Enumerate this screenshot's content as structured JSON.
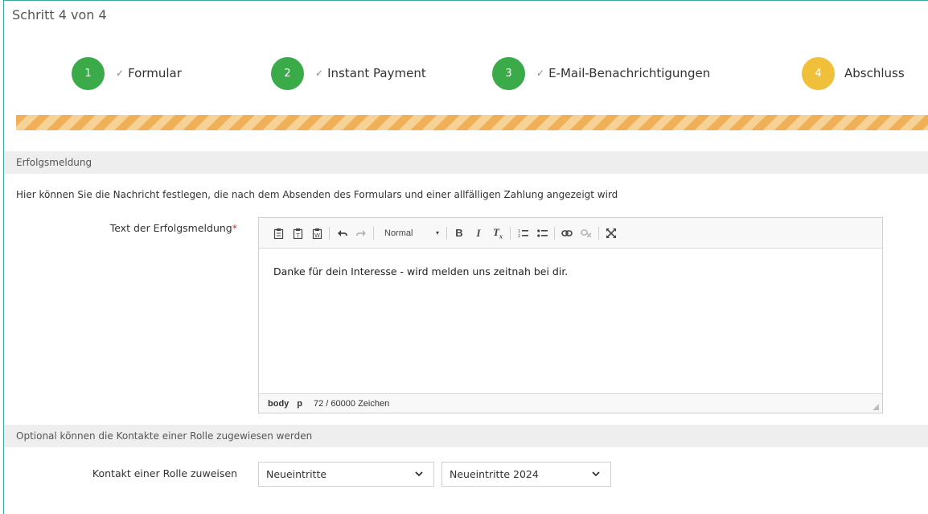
{
  "header": {
    "step_title": "Schritt 4 von 4"
  },
  "wizard": {
    "steps": [
      {
        "number": "1",
        "label": "Formular",
        "state": "done"
      },
      {
        "number": "2",
        "label": "Instant Payment",
        "state": "done"
      },
      {
        "number": "3",
        "label": "E-Mail-Benachrichtigungen",
        "state": "done"
      },
      {
        "number": "4",
        "label": "Abschluss",
        "state": "active"
      }
    ],
    "progress_percent": 100,
    "colors": {
      "done": "#3bab4a",
      "active": "#f0c03a",
      "progress": "#f0b057"
    }
  },
  "success_section": {
    "title": "Erfolgsmeldung",
    "intro": "Hier können Sie die Nachricht festlegen, die nach dem Absenden des Formulars und einer allfälligen Zahlung angezeigt wird",
    "field_label": "Text der Erfolgsmeldung",
    "required_mark": "*",
    "editor": {
      "format_value": "Normal",
      "content": "Danke für dein Interesse - wird melden uns zeitnah bei dir.",
      "status_path": [
        "body",
        "p"
      ],
      "char_count": "72 / 60000 Zeichen",
      "tools": [
        "paste-icon",
        "paste-text-icon",
        "paste-word-icon",
        "undo-icon",
        "redo-icon",
        "bold-icon",
        "italic-icon",
        "remove-format-icon",
        "numbered-list-icon",
        "bulleted-list-icon",
        "link-icon",
        "unlink-icon",
        "maximize-icon"
      ]
    }
  },
  "role_section": {
    "title": "Optional können die Kontakte einer Rolle zugewiesen werden",
    "field_label": "Kontakt einer Rolle zuweisen",
    "select_group": "Neueintritte",
    "select_role": "Neueintritte 2024"
  }
}
